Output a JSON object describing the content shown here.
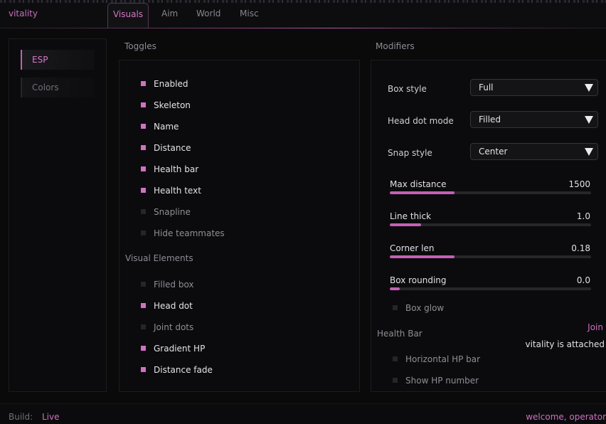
{
  "app": {
    "brand": "vitality"
  },
  "tabs": [
    {
      "label": "Visuals",
      "active": true
    },
    {
      "label": "Aim"
    },
    {
      "label": "World"
    },
    {
      "label": "Misc"
    }
  ],
  "sidebar": {
    "items": [
      {
        "label": "ESP",
        "active": true
      },
      {
        "label": "Colors"
      }
    ]
  },
  "toggles": {
    "title": "Toggles",
    "items": [
      {
        "label": "Enabled",
        "checked": true
      },
      {
        "label": "Skeleton",
        "checked": true
      },
      {
        "label": "Name",
        "checked": true
      },
      {
        "label": "Distance",
        "checked": true
      },
      {
        "label": "Health bar",
        "checked": true
      },
      {
        "label": "Health text",
        "checked": true
      },
      {
        "label": "Snapline",
        "checked": false
      },
      {
        "label": "Hide teammates",
        "checked": false
      }
    ],
    "visual_elements_title": "Visual Elements",
    "visual_elements": [
      {
        "label": "Filled box",
        "checked": false
      },
      {
        "label": "Head dot",
        "checked": true
      },
      {
        "label": "Joint dots",
        "checked": false
      },
      {
        "label": "Gradient HP",
        "checked": true
      },
      {
        "label": "Distance fade",
        "checked": true
      }
    ]
  },
  "modifiers": {
    "title": "Modifiers",
    "dropdowns": [
      {
        "label": "Box style",
        "value": "Full"
      },
      {
        "label": "Head dot mode",
        "value": "Filled"
      },
      {
        "label": "Snap style",
        "value": "Center"
      }
    ],
    "sliders": [
      {
        "label": "Max distance",
        "value": "1500",
        "fraction": 0.32
      },
      {
        "label": "Line thick",
        "value": "1.0",
        "fraction": 0.155
      },
      {
        "label": "Corner len",
        "value": "0.18",
        "fraction": 0.32
      },
      {
        "label": "Box rounding",
        "value": "0.0",
        "fraction": 0.05
      }
    ],
    "box_glow": {
      "label": "Box glow",
      "checked": false
    },
    "health_bar_title": "Health Bar",
    "join_label": "Join",
    "attached_text": "vitality is attached",
    "health_items": [
      {
        "label": "Horizontal HP bar",
        "checked": false
      },
      {
        "label": "Show HP number",
        "checked": false
      }
    ]
  },
  "footer": {
    "build_label": "Build:",
    "build_value": "Live",
    "welcome": "welcome, operator"
  },
  "colors": {
    "accent": "#d470c4",
    "background": "#0a0a0b"
  }
}
